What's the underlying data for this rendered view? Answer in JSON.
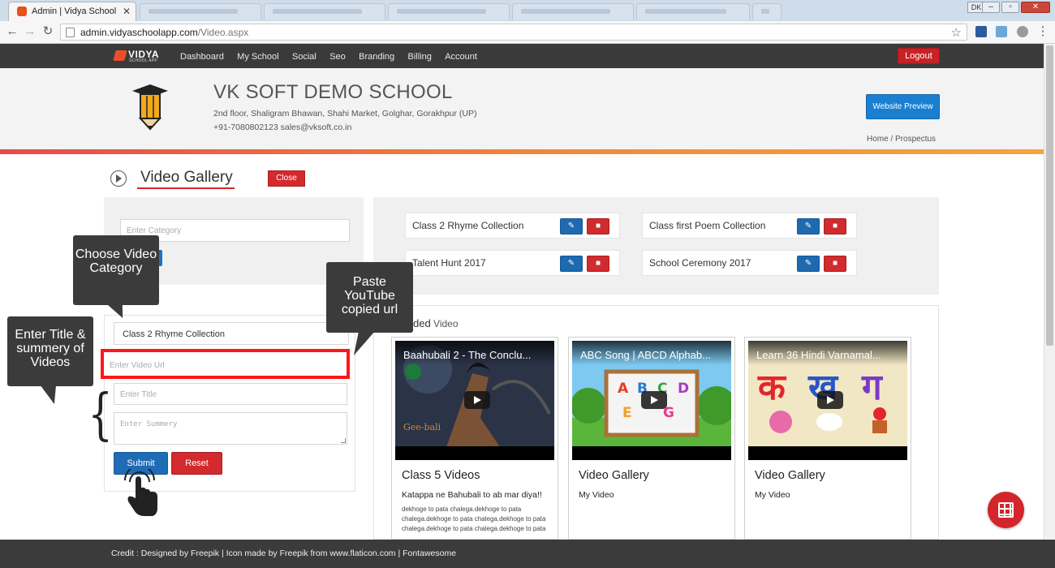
{
  "browser": {
    "active_tab_title": "Admin | Vidya School Ap",
    "url_domain": "admin.vidyaschoolapp.com",
    "url_path": "/Video.aspx",
    "profile_badge": "DK"
  },
  "nav": {
    "logo_word": "VIDYA",
    "logo_sub": "SCHOOL APP",
    "items": [
      "Dashboard",
      "My School",
      "Social",
      "Seo",
      "Branding",
      "Billing",
      "Account"
    ],
    "logout_label": "Logout"
  },
  "school": {
    "name": "VK SOFT DEMO SCHOOL",
    "address": "2nd floor, Shaligram Bhawan, Shahi Market, Golghar, Gorakhpur (UP)",
    "contact": "+91-7080802123  sales@vksoft.co.in",
    "preview_label": "Website Preview",
    "breadcrumb": "Home / Prospectus"
  },
  "page": {
    "title": "Video Gallery",
    "close_label": "Close"
  },
  "category_form": {
    "placeholder": "Enter Category"
  },
  "categories": [
    {
      "label": "Class 2 Rhyme Collection",
      "edit_icon": "edit-icon",
      "delete_icon": "trash-icon"
    },
    {
      "label": "Class first Poem Collection",
      "edit_icon": "edit-icon",
      "delete_icon": "trash-icon"
    },
    {
      "label": "Talent Hunt 2017",
      "edit_icon": "edit-icon",
      "delete_icon": "trash-icon"
    },
    {
      "label": "School Ceremony 2017",
      "edit_icon": "edit-icon",
      "delete_icon": "trash-icon"
    }
  ],
  "video_form": {
    "selected_category": "Class 2 Rhyme Collection",
    "url_placeholder": "Enter Video Url",
    "title_placeholder": "Enter Title",
    "summary_placeholder": "Enter Summery",
    "submit_label": "Submit",
    "reset_label": "Reset"
  },
  "videos_section": {
    "heading_big": "ded",
    "heading_small": " Video"
  },
  "videos": [
    {
      "thumb_title": "Baahubali 2 - The Conclu...",
      "title": "Class 5 Videos",
      "subtitle": "Katappa ne Bahubali to ab mar diya!!",
      "desc": "dekhoge to pata chalega.dekhoge to pata chalega.dekhoge to pata chalega.dekhoge to pata chalega.dekhoge to pata chalega.dekhoge to pata"
    },
    {
      "thumb_title": "ABC Song | ABCD Alphab...",
      "title": "Video Gallery",
      "subtitle": "My Video",
      "desc": ""
    },
    {
      "thumb_title": "Learn 36 Hindi Varnamal...",
      "title": "Video Gallery",
      "subtitle": "My Video",
      "desc": ""
    }
  ],
  "callouts": {
    "category": "Choose Video Category",
    "paste": "Paste YouTube copied url",
    "title": "Enter Title & summery of Videos"
  },
  "footer": {
    "credit": "Credit : Designed by Freepik | Icon made by Freepik from www.flaticon.com | Fontawesome"
  },
  "colors": {
    "nav_bg": "#3a3a3a",
    "danger": "#d12b2f",
    "primary": "#1e6ab0",
    "preview": "#1a7fd0",
    "highlight": "#ff1717"
  }
}
